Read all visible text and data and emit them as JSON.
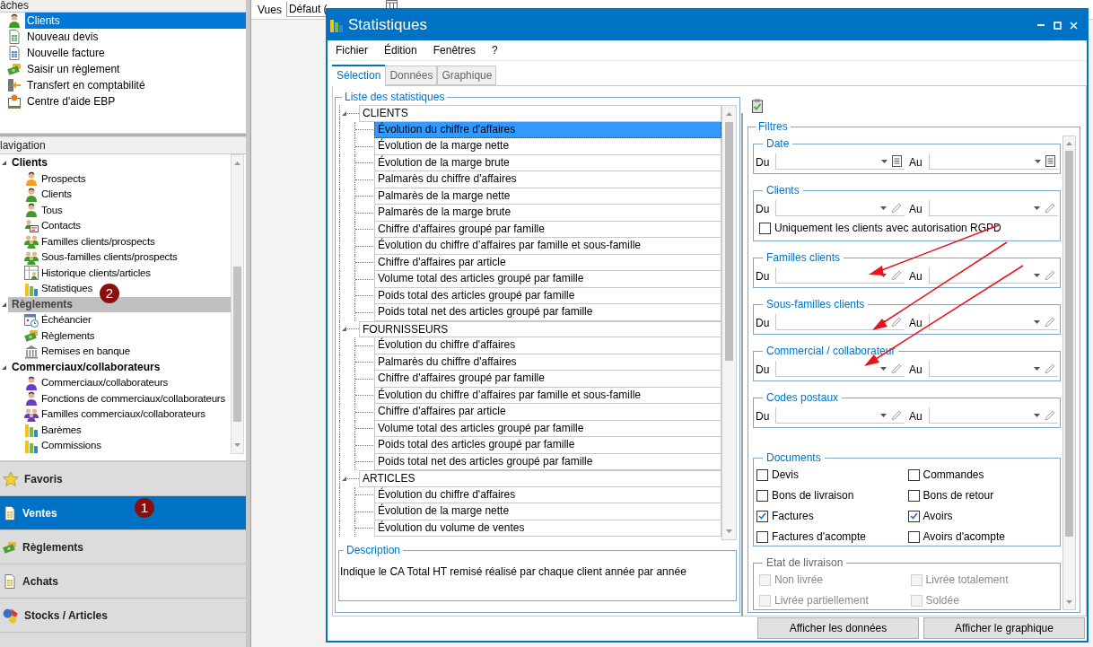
{
  "tasks_panel": {
    "header": "âches",
    "items": [
      {
        "label": "Clients",
        "selected": true
      },
      {
        "label": "Nouveau devis",
        "selected": false
      },
      {
        "label": "Nouvelle facture",
        "selected": false
      },
      {
        "label": "Saisir un règlement",
        "selected": false
      },
      {
        "label": "Transfert en comptabilité",
        "selected": false
      },
      {
        "label": "Centre d'aide EBP",
        "selected": false
      }
    ]
  },
  "navigation": {
    "header": "lavigation",
    "groups": [
      {
        "label": "Clients",
        "selected": false,
        "expanded": true,
        "children": [
          {
            "label": "Prospects"
          },
          {
            "label": "Clients"
          },
          {
            "label": "Tous"
          },
          {
            "label": "Contacts"
          },
          {
            "label": "Familles clients/prospects"
          },
          {
            "label": "Sous-familles clients/prospects"
          },
          {
            "label": "Historique clients/articles"
          },
          {
            "label": "Statistiques"
          }
        ]
      },
      {
        "label": "Règlements",
        "selected": true,
        "expanded": true,
        "children": [
          {
            "label": "Échéancier"
          },
          {
            "label": "Règlements"
          },
          {
            "label": "Remises en banque"
          }
        ]
      },
      {
        "label": "Commerciaux/collaborateurs",
        "selected": false,
        "expanded": true,
        "children": [
          {
            "label": "Commerciaux/collaborateurs"
          },
          {
            "label": "Fonctions de commerciaux/collaborateurs"
          },
          {
            "label": "Familles commerciaux/collaborateurs"
          },
          {
            "label": "Barèmes"
          },
          {
            "label": "Commissions"
          }
        ]
      }
    ]
  },
  "nav_buttons": [
    {
      "label": "Favoris",
      "selected": false
    },
    {
      "label": "Ventes",
      "selected": true
    },
    {
      "label": "Règlements",
      "selected": false
    },
    {
      "label": "Achats",
      "selected": false
    },
    {
      "label": "Stocks / Articles",
      "selected": false
    }
  ],
  "step_badges": [
    {
      "label": "1"
    },
    {
      "label": "2"
    }
  ],
  "views_bar": {
    "label": "Vues",
    "value": "Défaut ("
  },
  "window": {
    "title": "Statistiques",
    "menu": [
      "Fichier",
      "Édition",
      "Fenêtres",
      "?"
    ],
    "tabs": [
      {
        "label": "Sélection",
        "selected": true
      },
      {
        "label": "Données",
        "selected": false
      },
      {
        "label": "Graphique",
        "selected": false
      }
    ],
    "list_group": {
      "title": "Liste des statistiques",
      "tree": [
        {
          "label": "CLIENTS",
          "expanded": true,
          "children": [
            {
              "label": "Évolution du chiffre d'affaires",
              "selected": true
            },
            {
              "label": "Évolution de la marge nette",
              "selected": false
            },
            {
              "label": "Évolution de la marge brute",
              "selected": false
            },
            {
              "label": "Palmarès du chiffre d'affaires",
              "selected": false
            },
            {
              "label": "Palmarès de la marge nette",
              "selected": false
            },
            {
              "label": "Palmarès de la marge brute",
              "selected": false
            },
            {
              "label": "Chiffre d'affaires groupé par famille",
              "selected": false
            },
            {
              "label": "Évolution du chiffre d’affaires par famille et sous-famille",
              "selected": false
            },
            {
              "label": "Chiffre d'affaires par article",
              "selected": false
            },
            {
              "label": "Volume total des articles groupé par famille",
              "selected": false
            },
            {
              "label": "Poids total des articles groupé par famille",
              "selected": false
            },
            {
              "label": "Poids total net des articles groupé par famille",
              "selected": false
            }
          ]
        },
        {
          "label": "FOURNISSEURS",
          "expanded": true,
          "children": [
            {
              "label": "Évolution du chiffre d'affaires",
              "selected": false
            },
            {
              "label": "Palmarès du chiffre d'affaires",
              "selected": false
            },
            {
              "label": "Chiffre d'affaires groupé par famille",
              "selected": false
            },
            {
              "label": "Évolution du chiffre d’affaires par famille et sous-famille",
              "selected": false
            },
            {
              "label": "Chiffre d'affaires par article",
              "selected": false
            },
            {
              "label": "Volume total des articles groupé par famille",
              "selected": false
            },
            {
              "label": "Poids total des articles groupé par famille",
              "selected": false
            },
            {
              "label": "Poids total net des articles groupé par famille",
              "selected": false
            }
          ]
        },
        {
          "label": "ARTICLES",
          "expanded": true,
          "children": [
            {
              "label": "Évolution du chiffre d'affaires",
              "selected": false
            },
            {
              "label": "Évolution de la marge nette",
              "selected": false
            },
            {
              "label": "Évolution du volume de ventes",
              "selected": false
            }
          ]
        }
      ]
    },
    "description": {
      "title": "Description",
      "text": "Indique le CA Total HT remisé réalisé par chaque client année par année"
    },
    "filters": {
      "title": "Filtres",
      "ranges": [
        {
          "title": "Date",
          "kind": "date",
          "from_label": "Du",
          "to_label": "Au"
        },
        {
          "title": "Clients",
          "kind": "lookup",
          "from_label": "Du",
          "to_label": "Au",
          "option": {
            "label": "Uniquement les clients avec autorisation RGPD",
            "checked": false
          }
        },
        {
          "title": "Familles clients",
          "kind": "lookup",
          "from_label": "Du",
          "to_label": "Au"
        },
        {
          "title": "Sous-familles clients",
          "kind": "lookup",
          "from_label": "Du",
          "to_label": "Au"
        },
        {
          "title": "Commercial / collaborateur",
          "kind": "lookup",
          "from_label": "Du",
          "to_label": "Au"
        },
        {
          "title": "Codes postaux",
          "kind": "lookup",
          "from_label": "Du",
          "to_label": "Au"
        }
      ],
      "documents": {
        "title": "Documents",
        "items": [
          {
            "label": "Devis",
            "checked": false
          },
          {
            "label": "Commandes",
            "checked": false
          },
          {
            "label": "Bons de livraison",
            "checked": false
          },
          {
            "label": "Bons de retour",
            "checked": false
          },
          {
            "label": "Factures",
            "checked": true
          },
          {
            "label": "Avoirs",
            "checked": true
          },
          {
            "label": "Factures d'acompte",
            "checked": false
          },
          {
            "label": "Avoirs d'acompte",
            "checked": false
          }
        ]
      },
      "delivery": {
        "title": "Etat de livraison",
        "disabled": true,
        "items": [
          {
            "label": "Non livrée",
            "checked": false
          },
          {
            "label": "Livrée totalement",
            "checked": false
          },
          {
            "label": "Livrée partiellement",
            "checked": false
          },
          {
            "label": "Soldée",
            "checked": false
          }
        ]
      }
    },
    "buttons": [
      "Afficher les données",
      "Afficher le graphique"
    ]
  }
}
